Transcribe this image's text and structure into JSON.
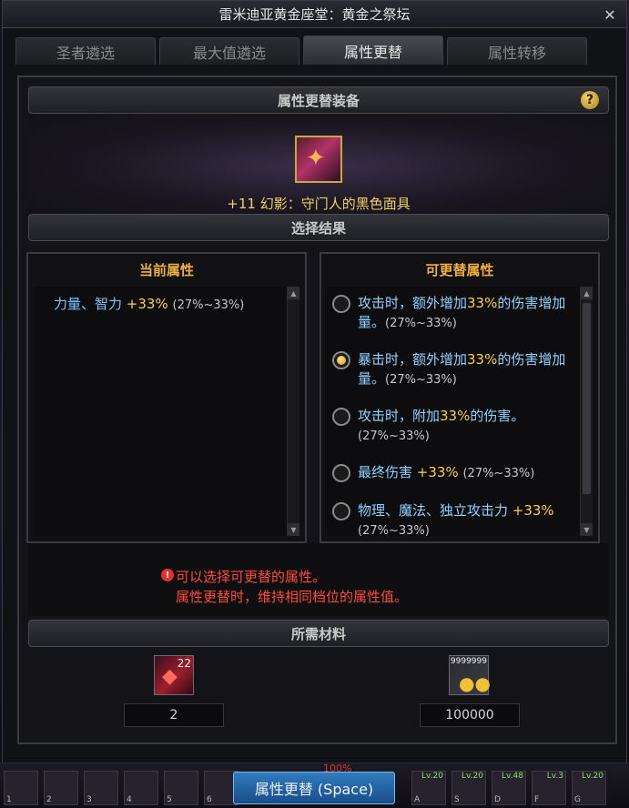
{
  "window": {
    "title": "雷米迪亚黄金座堂：黄金之祭坛"
  },
  "tabs": [
    {
      "label": "圣者遴选"
    },
    {
      "label": "最大值遴选"
    },
    {
      "label": "属性更替"
    },
    {
      "label": "属性转移"
    }
  ],
  "equip_section": {
    "title": "属性更替装备",
    "help": "?"
  },
  "equipment": {
    "name": "+11 幻影：守门人的黑色面具"
  },
  "result_section": {
    "title": "选择结果"
  },
  "current": {
    "title": "当前属性",
    "stat": "力量、智力",
    "value": "+33%",
    "range": "(27%~33%)"
  },
  "options": {
    "title": "可更替属性",
    "items": [
      {
        "a": "攻击时，额外增加",
        "v": "33%",
        "b": "的伤害增加量。",
        "r": "(27%~33%)",
        "selected": false
      },
      {
        "a": "暴击时，额外增加",
        "v": "33%",
        "b": "的伤害增加量。",
        "r": "(27%~33%)",
        "selected": true
      },
      {
        "a": "攻击时，附加",
        "v": "33%",
        "b": "的伤害。",
        "r": "(27%~33%)",
        "selected": false
      },
      {
        "a": "最终伤害 ",
        "v": "+33%",
        "b": "",
        "r": "(27%~33%)",
        "selected": false
      },
      {
        "a": "物理、魔法、独立攻击力 ",
        "v": "+33%",
        "b": "",
        "r": "(27%~33%)",
        "selected": false
      }
    ]
  },
  "notice": {
    "icon": "!",
    "line1": "可以选择可更替的属性。",
    "line2": "属性更替时，维持相同档位的属性值。"
  },
  "materials_section": {
    "title": "所需材料"
  },
  "materials": [
    {
      "icon": "gem-icon",
      "badge": "22",
      "count": "2"
    },
    {
      "icon": "gold-coin-icon",
      "badge": "9999999",
      "count": "100000"
    }
  ],
  "hud": {
    "percent": "100%",
    "slots": [
      {
        "key": "1"
      },
      {
        "key": "2"
      },
      {
        "key": "3"
      },
      {
        "key": "4"
      },
      {
        "key": "5"
      },
      {
        "key": "6"
      }
    ],
    "right_slots": [
      {
        "key": "A",
        "lv": "Lv.20"
      },
      {
        "key": "S",
        "lv": "Lv.20"
      },
      {
        "key": "D",
        "lv": "Lv.48"
      },
      {
        "key": "F",
        "lv": "Lv.3"
      },
      {
        "key": "G",
        "lv": "Lv.20"
      }
    ]
  },
  "confirm_button": {
    "label": "属性更替 (Space)"
  },
  "colors": {
    "accent_gold": "#f0b040",
    "option_text": "#8fd2ff",
    "warning": "#ff4a3a",
    "button": "#2f7cc0"
  }
}
